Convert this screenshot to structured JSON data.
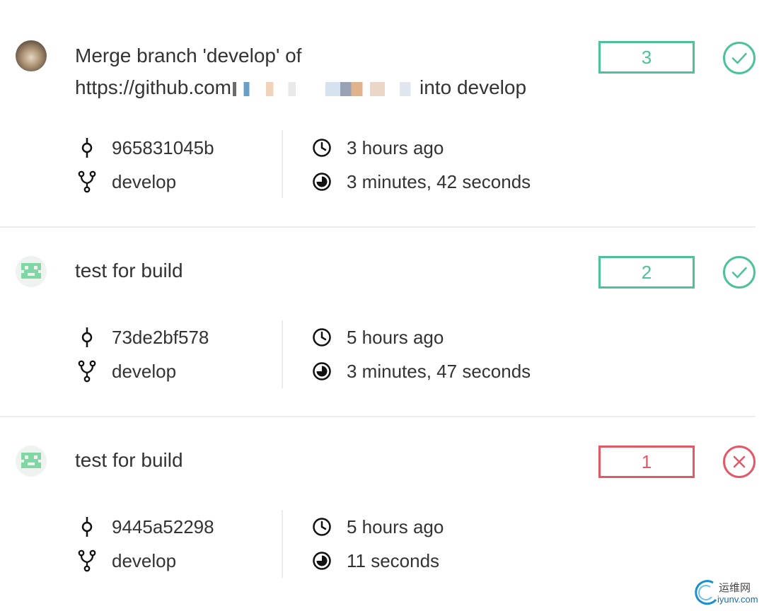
{
  "colors": {
    "success": "#4dc19a",
    "failure": "#e35867",
    "text": "#333333",
    "divider": "#ececec"
  },
  "builds": [
    {
      "avatar": "user-photo",
      "title_start": "Merge branch 'develop' of",
      "title_line2_prefix": "https://github.com",
      "title_line2_suffix": "into develop",
      "number": "3",
      "status": "success",
      "commit": "965831045b",
      "branch": "develop",
      "started": "3 hours ago",
      "duration": "3 minutes, 42 seconds"
    },
    {
      "avatar": "identicon",
      "title": "test for build",
      "number": "2",
      "status": "success",
      "commit": "73de2bf578",
      "branch": "develop",
      "started": "5 hours ago",
      "duration": "3 minutes, 47 seconds"
    },
    {
      "avatar": "identicon",
      "title": "test for build",
      "number": "1",
      "status": "failure",
      "commit": "9445a52298",
      "branch": "develop",
      "started": "5 hours ago",
      "duration": "11 seconds"
    }
  ],
  "icons": {
    "commit": "commit-icon",
    "branch": "branch-icon",
    "started": "clock-icon",
    "duration": "timer-icon",
    "success": "check-circle-icon",
    "failure": "x-circle-icon"
  },
  "watermark": {
    "cn": "运维网",
    "en": "iyunv.com"
  }
}
